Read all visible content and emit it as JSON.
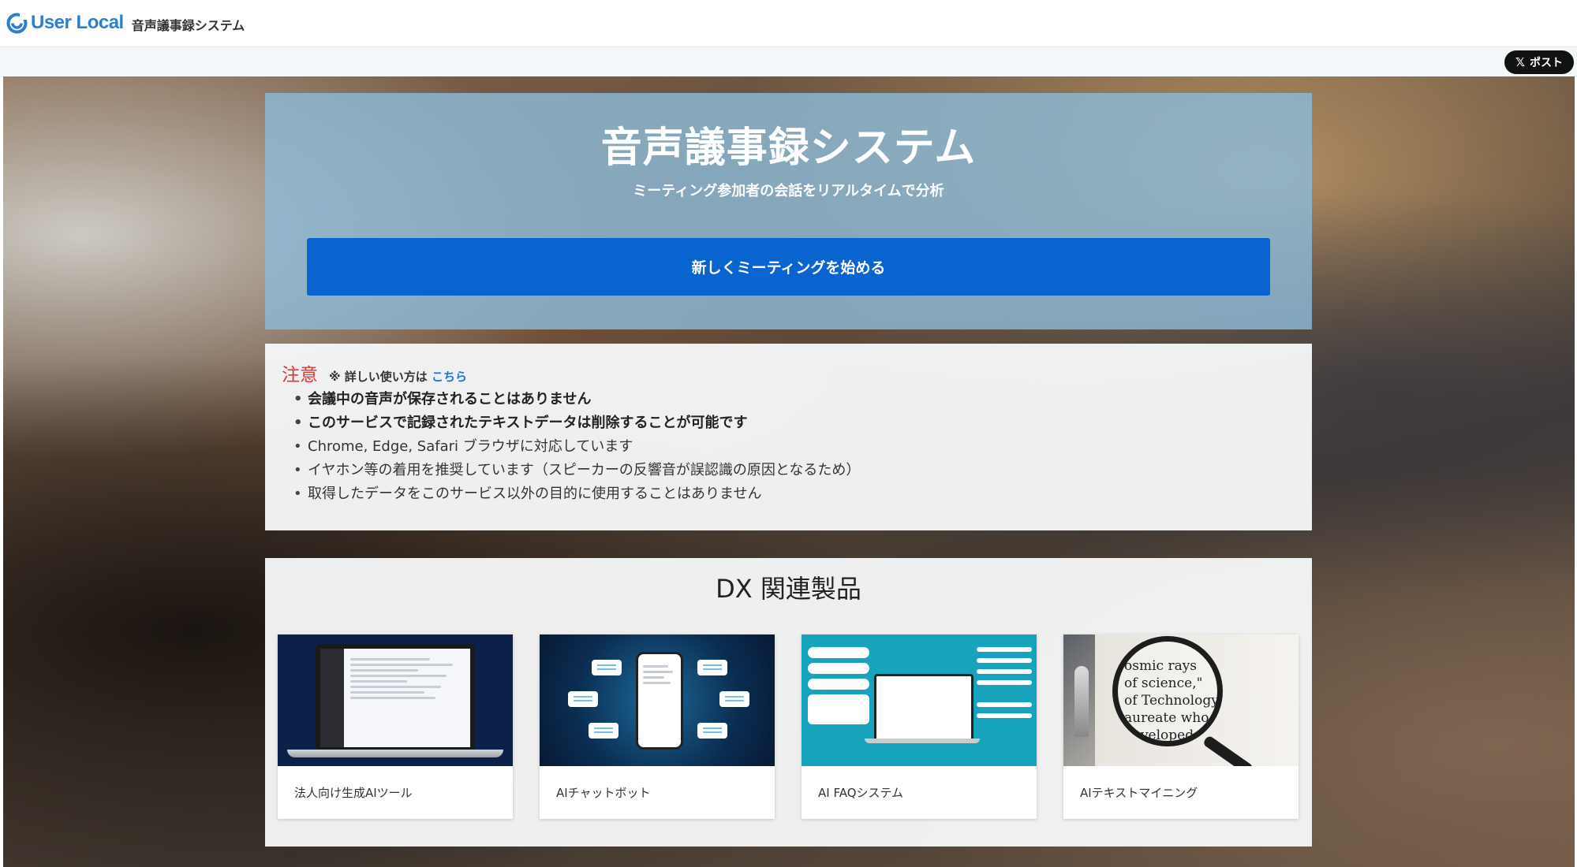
{
  "header": {
    "brand": "User Local",
    "product": "音声議事録システム",
    "post_button": "ポスト",
    "post_icon": "x-logo-icon"
  },
  "hero": {
    "title": "音声議事録システム",
    "subtitle": "ミーティング参加者の会話をリアルタイムで分析",
    "start_button": "新しくミーティングを始める"
  },
  "notice": {
    "label": "注意",
    "help_prefix": "※ 詳しい使い方は",
    "help_link": "こちら",
    "items": [
      "会議中の音声が保存されることはありません",
      "このサービスで記録されたテキストデータは削除することが可能です",
      "Chrome, Edge, Safari ブラウザに対応しています",
      "イヤホン等の着用を推奨しています（スピーカーの反響音が誤認識の原因となるため）",
      "取得したデータをこのサービス以外の目的に使用することはありません"
    ]
  },
  "dx": {
    "title": "DX 関連製品",
    "products": [
      {
        "label": "法人向け生成AIツール"
      },
      {
        "label": "AIチャットボット"
      },
      {
        "label": "AI FAQシステム"
      },
      {
        "label": "AIテキストマイニング"
      }
    ],
    "lens_text": "osmic rays\nof science,\"\nof Technology p\naureate who he\ndeveloped the"
  },
  "colors": {
    "brand_blue": "#2a7fd4",
    "start_button": "#0a64d0",
    "notice_red": "#e03535",
    "link_blue": "#1a73e8"
  }
}
